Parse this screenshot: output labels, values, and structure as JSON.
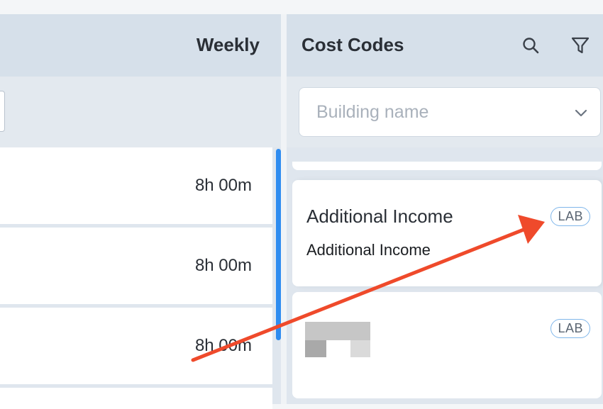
{
  "weekly_panel": {
    "title": "Weekly",
    "rows": [
      {
        "hours": "8h 00m"
      },
      {
        "hours": "8h 00m"
      },
      {
        "hours": "8h 00m"
      }
    ]
  },
  "cost_codes_panel": {
    "title": "Cost Codes",
    "search_icon": "search-icon",
    "filter_icon": "filter-icon",
    "building_select": {
      "placeholder": "Building name",
      "icon": "chevron-down-icon"
    },
    "cards": [
      {
        "title": "Additional Income",
        "description": "Additional Income",
        "badge": "LAB"
      },
      {
        "title": "",
        "description": "",
        "badge": "LAB",
        "redacted": true
      }
    ]
  },
  "annotation": {
    "type": "arrow",
    "color": "#ef4a2b"
  },
  "colors": {
    "header_bg": "#d6e0ea",
    "panel_bg": "#dfe6ee",
    "scroll_thumb": "#2f8cf0",
    "badge_border": "#7fb6ea",
    "annotation": "#ef4a2b"
  }
}
